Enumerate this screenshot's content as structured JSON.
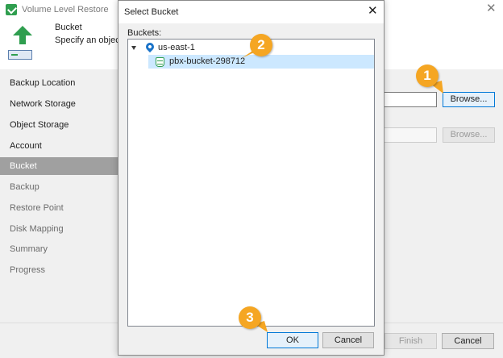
{
  "wizard": {
    "title": "Volume Level Restore",
    "header": {
      "step_title": "Bucket",
      "step_description": "Specify an object s"
    },
    "nav": [
      {
        "label": "Backup Location",
        "state": "done"
      },
      {
        "label": "Network Storage",
        "state": "done"
      },
      {
        "label": "Object Storage",
        "state": "done"
      },
      {
        "label": "Account",
        "state": "done"
      },
      {
        "label": "Bucket",
        "state": "active"
      },
      {
        "label": "Backup",
        "state": "pending"
      },
      {
        "label": "Restore Point",
        "state": "pending"
      },
      {
        "label": "Disk Mapping",
        "state": "pending"
      },
      {
        "label": "Summary",
        "state": "pending"
      },
      {
        "label": "Progress",
        "state": "pending"
      }
    ],
    "browse_label": "Browse...",
    "browse_disabled_label": "Browse...",
    "finish_label": "Finish",
    "cancel_label": "Cancel"
  },
  "dialog": {
    "title": "Select Bucket",
    "tree_label": "Buckets:",
    "tree": {
      "region": "us-east-1",
      "buckets": [
        "pbx-bucket-298712"
      ],
      "selected_bucket": "pbx-bucket-298712"
    },
    "ok_label": "OK",
    "cancel_label": "Cancel"
  },
  "markers": [
    "1",
    "2",
    "3"
  ],
  "colors": {
    "accent": "#0078d7",
    "marker": "#f5a623",
    "selection": "#cce8ff",
    "nav_active": "#a0a0a0",
    "brand_green": "#2f9e4f"
  },
  "icons": {
    "app": "restore-icon",
    "header": "volume-restore-icon",
    "region": "location-pin-icon",
    "bucket": "bucket-icon",
    "close": "close-icon"
  }
}
